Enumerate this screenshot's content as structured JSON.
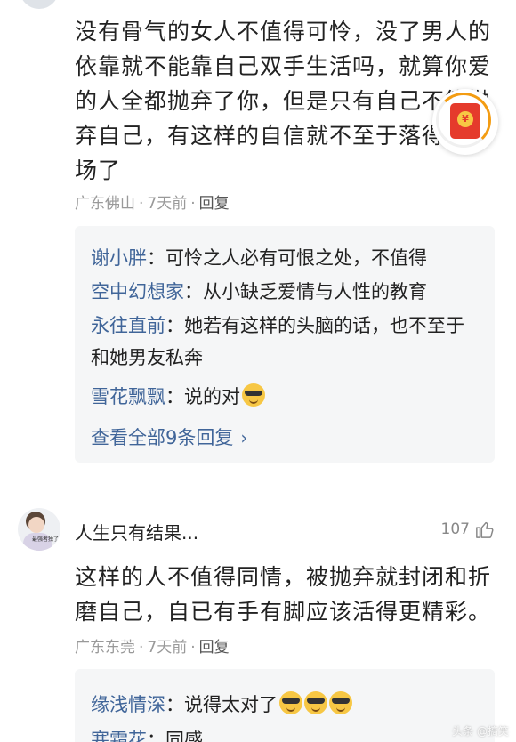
{
  "comment1": {
    "text": "没有骨气的女人不值得可怜，没了男人的依靠就不能靠自己双手生活吗，就算你爱的人全都抛弃了你，但是只有自己不能抛弃自己，有这样的自信就不至于落得这下场了",
    "location": "广东佛山",
    "time": "7天前",
    "reply_label": "回复",
    "replies": [
      {
        "name": "谢小胖",
        "text": "可怜之人必有可恨之处，不值得",
        "emoji_count": 0
      },
      {
        "name": "空中幻想家",
        "text": "从小缺乏爱情与人性的教育",
        "emoji_count": 0
      },
      {
        "name": "永往直前",
        "text": "她若有这样的头脑的话，也不至于和她男友私奔",
        "emoji_count": 0
      },
      {
        "name": "雪花飘飘",
        "text": "说的对",
        "emoji_count": 1
      }
    ],
    "view_all": "查看全部9条回复"
  },
  "comment2": {
    "username": "人生只有结果...",
    "likes": "107",
    "avatar_caption": "最强者独了",
    "text": "这样的人不值得同情，被抛弃就封闭和折磨自己，自已有手有脚应该活得更精彩。",
    "location": "广东东莞",
    "time": "7天前",
    "reply_label": "回复",
    "replies": [
      {
        "name": "缘浅情深",
        "text": "说得太对了",
        "emoji_count": 3
      },
      {
        "name": "寒霜花",
        "text": "同感",
        "emoji_count": 0
      }
    ]
  },
  "watermark": "头条 @搞笑",
  "icons": {
    "redpacket": "red-envelope-icon",
    "thumb": "thumbs-up-icon",
    "chevron": "chevron-right-icon",
    "emoji": "sunglasses-emoji-icon"
  },
  "colors": {
    "link_blue": "#406599",
    "meta_gray": "#999999",
    "reply_bg": "#f5f6f7",
    "red": "#e53b2c"
  }
}
